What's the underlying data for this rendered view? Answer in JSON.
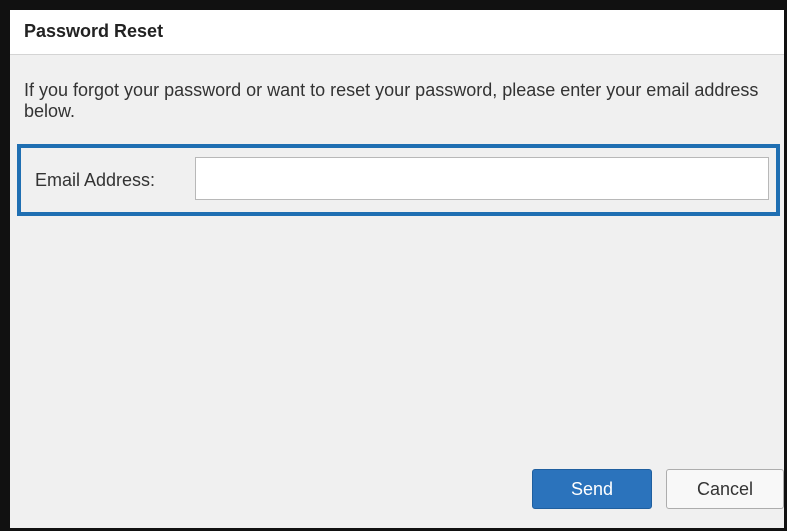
{
  "dialog": {
    "title": "Password Reset",
    "description": "If you forgot your password or want to reset your password, please enter your email address below."
  },
  "form": {
    "email_label": "Email Address:",
    "email_value": "",
    "email_placeholder": ""
  },
  "buttons": {
    "send_label": "Send",
    "cancel_label": "Cancel"
  },
  "colors": {
    "primary": "#2b73bc",
    "focus_border": "#1f6fb2",
    "background": "#f0f0f0"
  }
}
